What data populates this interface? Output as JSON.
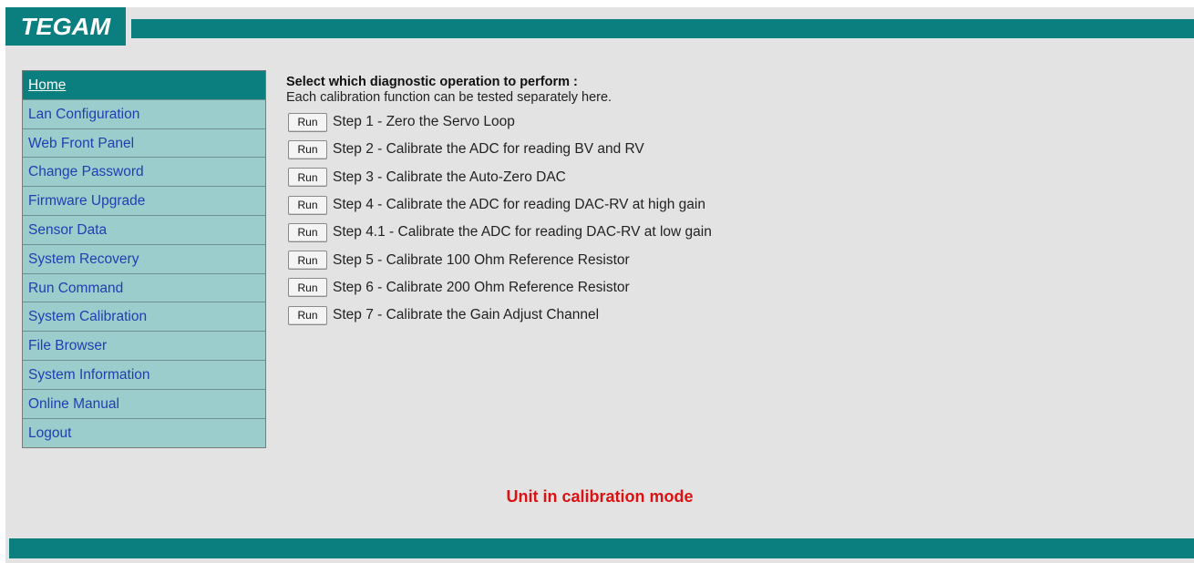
{
  "brand": {
    "logo_text": "TEGAM"
  },
  "colors": {
    "accent": "#0b7f80",
    "nav_bg": "#9bcdcd",
    "link": "#1e40b0",
    "status": "#dd1111",
    "page_bg": "#e3e3e3"
  },
  "sidebar": {
    "items": [
      {
        "label": "Home",
        "active": true
      },
      {
        "label": "Lan Configuration"
      },
      {
        "label": "Web Front Panel"
      },
      {
        "label": "Change Password"
      },
      {
        "label": "Firmware Upgrade"
      },
      {
        "label": "Sensor Data"
      },
      {
        "label": "System Recovery"
      },
      {
        "label": "Run Command"
      },
      {
        "label": "System Calibration"
      },
      {
        "label": "File Browser"
      },
      {
        "label": "System Information"
      },
      {
        "label": "Online Manual"
      },
      {
        "label": "Logout"
      }
    ]
  },
  "main": {
    "heading": "Select which diagnostic operation to perform :",
    "subheading": "Each calibration function can be tested separately here.",
    "run_label": "Run",
    "steps": [
      {
        "label": "Step 1 - Zero the Servo Loop"
      },
      {
        "label": "Step 2 - Calibrate the ADC for reading BV and RV"
      },
      {
        "label": "Step 3 - Calibrate the Auto-Zero DAC"
      },
      {
        "label": "Step 4 - Calibrate the ADC for reading DAC-RV at high gain"
      },
      {
        "label": "Step 4.1 - Calibrate the ADC for reading DAC-RV at low gain"
      },
      {
        "label": "Step 5 - Calibrate 100 Ohm Reference Resistor"
      },
      {
        "label": "Step 6 - Calibrate 200 Ohm Reference Resistor"
      },
      {
        "label": "Step 7 - Calibrate the Gain Adjust Channel"
      }
    ]
  },
  "status": {
    "text": "Unit in calibration mode"
  }
}
